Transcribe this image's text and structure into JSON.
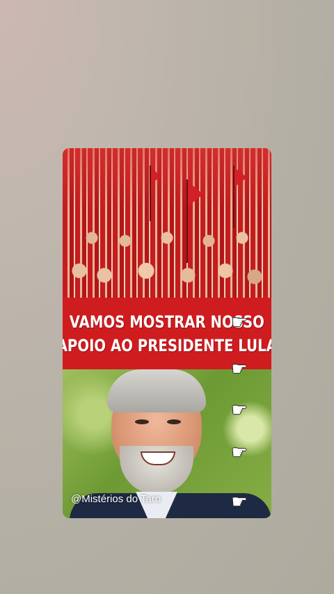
{
  "post": {
    "headline_line1": "VAMOS MOSTRAR NOSSO",
    "headline_line2": "APOIO AO PRESIDENTE LULA",
    "watermark": "@Mistérios do Taro"
  },
  "icons": {
    "pointer": "pointing-hand-icon",
    "glyph": "☛"
  },
  "colors": {
    "banner_red": "#cf1c1f",
    "text_white": "#ffffff"
  }
}
